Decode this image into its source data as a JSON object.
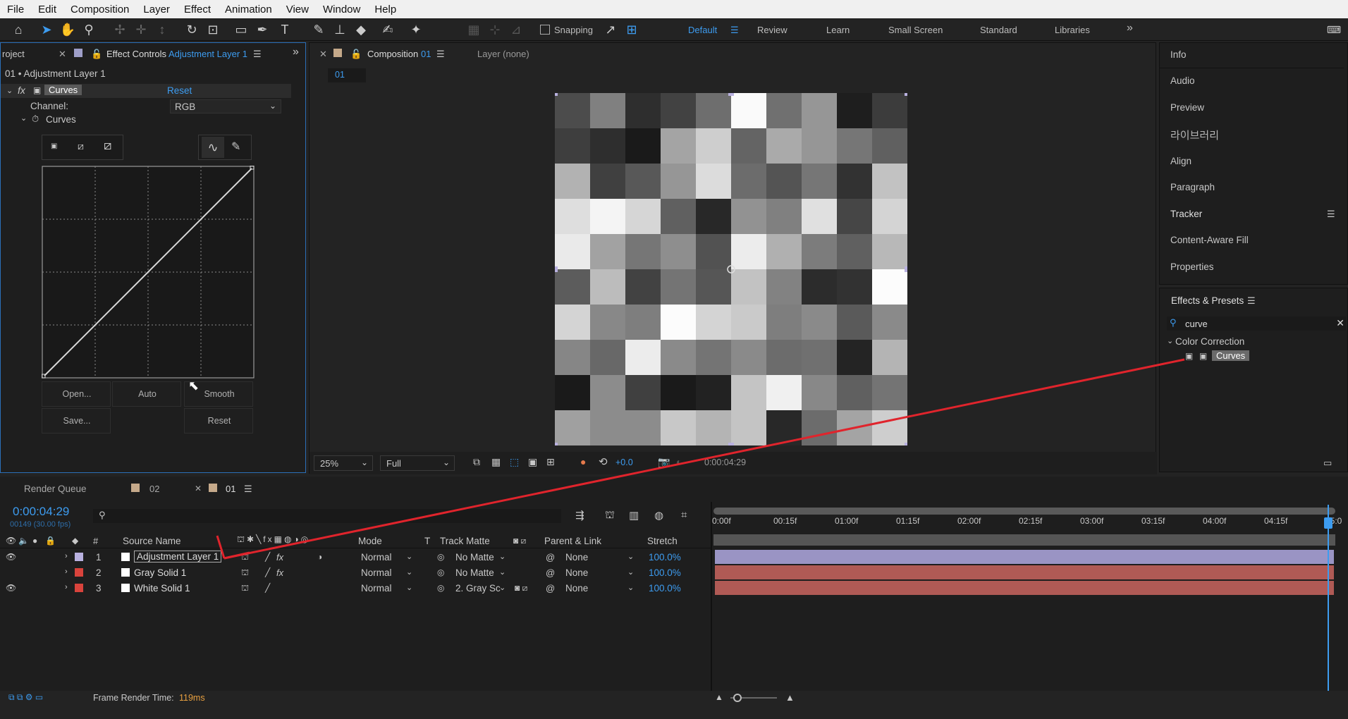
{
  "menu": [
    "File",
    "Edit",
    "Composition",
    "Layer",
    "Effect",
    "Animation",
    "View",
    "Window",
    "Help"
  ],
  "toolbar": {
    "snapping": "Snapping",
    "workspaces": [
      "Default",
      "Review",
      "Learn",
      "Small Screen",
      "Standard",
      "Libraries"
    ],
    "active_workspace": "Default"
  },
  "effect_panel": {
    "project_tab": "roject",
    "tab_label": "Effect Controls",
    "layer_name": "Adjustment Layer 1",
    "header": "01 • Adjustment Layer 1",
    "effect_name": "Curves",
    "reset": "Reset",
    "channel_label": "Channel:",
    "channel_value": "RGB",
    "curves_label": "Curves",
    "buttons": {
      "open": "Open...",
      "auto": "Auto",
      "smooth": "Smooth",
      "save": "Save...",
      "reset": "Reset"
    }
  },
  "composition": {
    "tab_label": "Composition",
    "comp_name": "01",
    "layer_tab": "Layer (none)",
    "breadcrumb": "01",
    "zoom": "25%",
    "resolution": "Full",
    "exposure": "+0.0",
    "timecode": "0:00:04:29"
  },
  "right_panels": {
    "items": [
      "Info",
      "Audio",
      "Preview",
      "라이브러리",
      "Align",
      "Paragraph",
      "Tracker",
      "Content-Aware Fill",
      "Properties"
    ],
    "effects_title": "Effects & Presets",
    "search_value": "curve",
    "category": "Color Correction",
    "result": "Curves"
  },
  "timeline": {
    "tabs": {
      "render_queue": "Render Queue",
      "comp_02": "02",
      "comp_01": "01"
    },
    "timecode": "0:00:04:29",
    "frame_info": "00149 (30.00 fps)",
    "headers": {
      "num": "#",
      "source": "Source Name",
      "mode": "Mode",
      "t": "T",
      "track_matte": "Track Matte",
      "parent": "Parent & Link",
      "stretch": "Stretch"
    },
    "ruler": [
      "0:00f",
      "00:15f",
      "01:00f",
      "01:15f",
      "02:00f",
      "02:15f",
      "03:00f",
      "03:15f",
      "04:00f",
      "04:15f",
      "05:0"
    ],
    "layers": [
      {
        "num": "1",
        "name": "Adjustment Layer 1",
        "mode": "Normal",
        "matte": "No Matte",
        "parent": "None",
        "stretch": "100.0%",
        "color": "#b9b1e0",
        "bar": "#9a94c4"
      },
      {
        "num": "2",
        "name": "Gray Solid 1",
        "mode": "Normal",
        "matte": "No Matte",
        "parent": "None",
        "stretch": "100.0%",
        "color": "#d9433c",
        "bar": "#b05a55"
      },
      {
        "num": "3",
        "name": "White Solid 1",
        "mode": "Normal",
        "matte": "2. Gray Sc",
        "parent": "None",
        "stretch": "100.0%",
        "color": "#d9433c",
        "bar": "#b05a55"
      }
    ]
  },
  "status": {
    "label": "Frame Render Time:",
    "value": "119ms"
  },
  "colors": {
    "accent": "#3d9cf0",
    "arrow": "#e0242c"
  }
}
